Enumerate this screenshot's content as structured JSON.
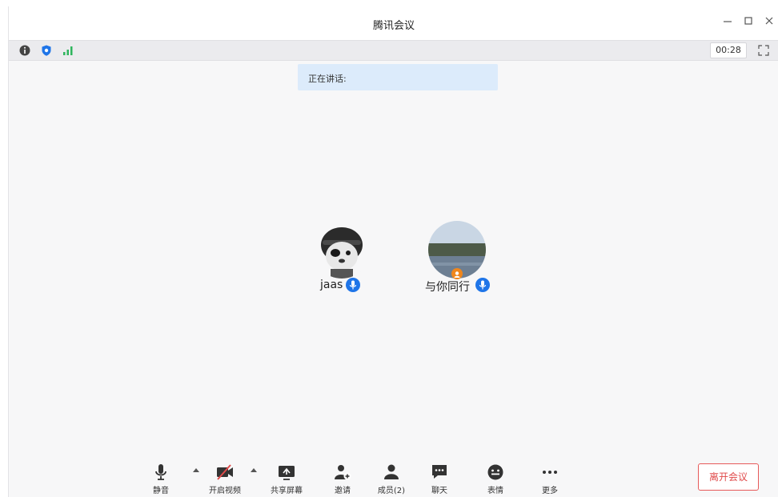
{
  "window": {
    "title": "腾讯会议"
  },
  "status": {
    "timer": "00:28"
  },
  "speaking": {
    "label": "正在讲话:"
  },
  "participants": [
    {
      "name": "jaas"
    },
    {
      "name": "与你同行"
    }
  ],
  "toolbar": {
    "mute": "静音",
    "video": "开启视频",
    "share": "共享屏幕",
    "invite": "邀请",
    "members": "成员(2)",
    "chat": "聊天",
    "emoji": "表情",
    "more": "更多"
  },
  "leave": {
    "label": "离开会议"
  },
  "colors": {
    "accent": "#1f75e8",
    "danger": "#e04a4a",
    "signal": "#2fb55d"
  }
}
